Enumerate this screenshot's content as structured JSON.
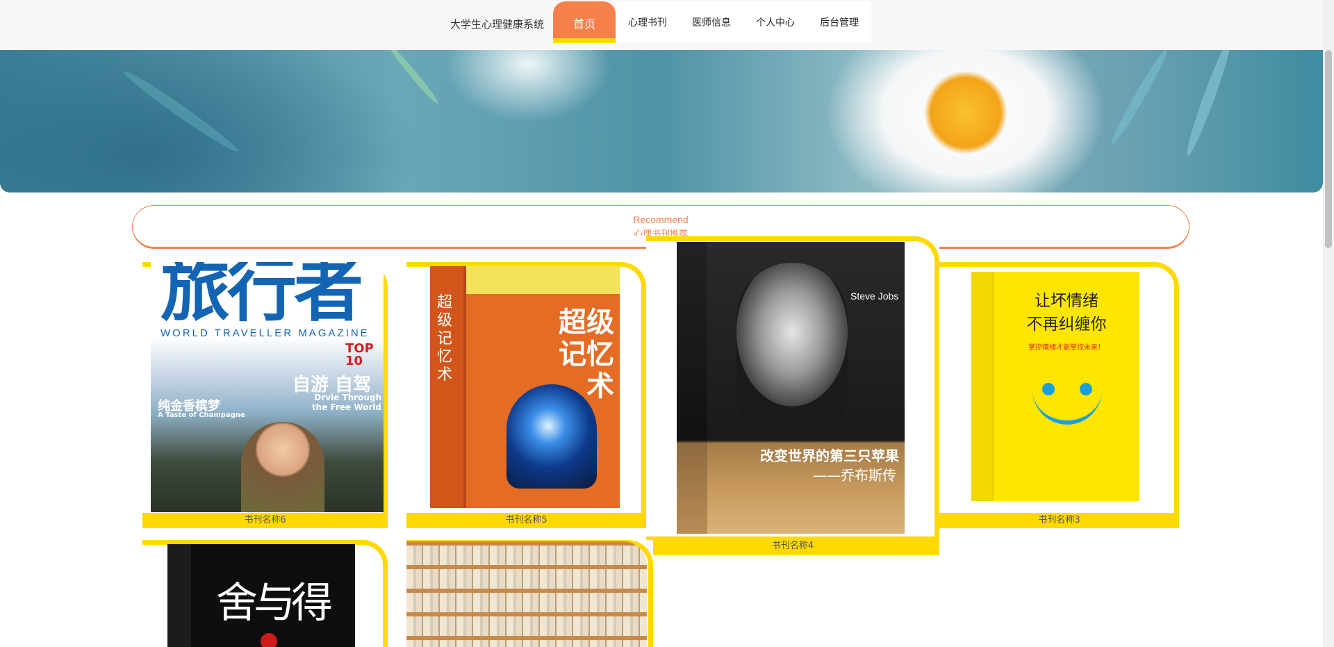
{
  "brand": "大学生心理健康系统",
  "nav": [
    {
      "label": "首页",
      "active": true
    },
    {
      "label": "心理书刊",
      "active": false
    },
    {
      "label": "医师信息",
      "active": false
    },
    {
      "label": "个人中心",
      "active": false
    },
    {
      "label": "后台管理",
      "active": false
    }
  ],
  "section": {
    "en": "Recommend",
    "cn": "心理书刊推荐"
  },
  "books": [
    {
      "caption": "书刊名称6",
      "cover": {
        "title": "旅行者",
        "subtitle": "WORLD TRAVELLER MAGAZINE",
        "line1": "纯金香槟梦",
        "line2": "A Taste of Champagne",
        "line3": "自游 自驾",
        "line4": "Drvie Through the Free World",
        "badge": "TOP 10"
      }
    },
    {
      "caption": "书刊名称5",
      "cover": {
        "title": "超级记忆术",
        "spine": "超级记忆术"
      }
    },
    {
      "caption": "书刊名称4",
      "cover": {
        "title": "改变世界的第三只苹果",
        "subtitle": "——乔布斯传",
        "name": "Steve Jobs"
      }
    },
    {
      "caption": "书刊名称3",
      "cover": {
        "title": "让坏情绪",
        "title2": "不再纠缠你",
        "subtitle": "掌控情绪才能掌控未来！"
      }
    },
    {
      "caption": "",
      "cover": {
        "title": "舍与得"
      }
    },
    {
      "caption": "",
      "cover": {
        "title": ""
      }
    }
  ],
  "colors": {
    "accent": "#f5804a",
    "yellow": "#ffd900"
  }
}
